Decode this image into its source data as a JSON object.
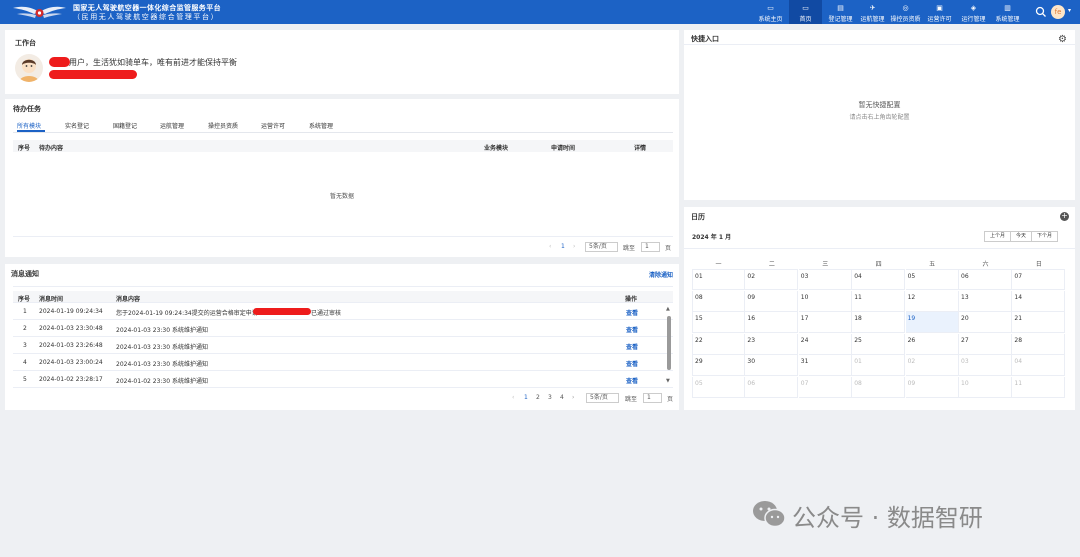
{
  "header": {
    "title_line1": "国家无人驾驶航空器一体化综合监管服务平台",
    "title_line2": "（民用无人驾驶航空器综合管理平台）",
    "nav": [
      {
        "label": "系统主页",
        "icon": "home-screen-icon"
      },
      {
        "label": "首页",
        "icon": "monitor-icon",
        "active": true
      },
      {
        "label": "登记管理",
        "icon": "register-icon"
      },
      {
        "label": "运航管理",
        "icon": "drone-icon"
      },
      {
        "label": "操控员资质",
        "icon": "badge-icon"
      },
      {
        "label": "运营许可",
        "icon": "license-icon"
      },
      {
        "label": "运行管理",
        "icon": "operation-icon"
      },
      {
        "label": "系统管理",
        "icon": "settings-icon"
      }
    ],
    "avatar_text": "fe"
  },
  "workbench": {
    "title": "工作台",
    "greeting": "用户，生活犹如骑单车，唯有前进才能保持平衡"
  },
  "tasks": {
    "title": "待办任务",
    "tabs": [
      "所有模块",
      "实名登记",
      "国籍登记",
      "运航管理",
      "操控员资质",
      "运营许可",
      "系统管理"
    ],
    "columns": [
      "序号",
      "待办内容",
      "业务模块",
      "申请时间",
      "详情"
    ],
    "empty_text": "暂无数据",
    "pager": {
      "prev": "‹",
      "page": "1",
      "next": "›",
      "page_size": "5条/页",
      "goto_label": "跳至",
      "goto_value": "1",
      "page_unit": "页"
    }
  },
  "messages": {
    "title": "消息通知",
    "clear_label": "清除通知",
    "columns": [
      "序号",
      "消息时间",
      "消息内容",
      "操作"
    ],
    "rows": [
      {
        "no": "1",
        "time": "2024-01-19 09:24:34",
        "content": "您于2024-01-19 09:24:34提交的运营合格审定申请",
        "content_tail": "已通过审核",
        "action": "查看"
      },
      {
        "no": "2",
        "time": "2024-01-03 23:30:48",
        "content": "2024-01-03 23:30 系统维护通知",
        "action": "查看"
      },
      {
        "no": "3",
        "time": "2024-01-03 23:26:48",
        "content": "2024-01-03 23:30 系统维护通知",
        "action": "查看"
      },
      {
        "no": "4",
        "time": "2024-01-03 23:00:24",
        "content": "2024-01-03 23:30 系统维护通知",
        "action": "查看"
      },
      {
        "no": "5",
        "time": "2024-01-02 23:28:17",
        "content": "2024-01-02 23:30 系统维护通知",
        "action": "查看"
      }
    ],
    "pager": {
      "prev": "‹",
      "pages": [
        "1",
        "2",
        "3",
        "4"
      ],
      "active_page": "1",
      "next": "›",
      "page_size": "5条/页",
      "goto_label": "跳至",
      "goto_value": "1",
      "page_unit": "页"
    }
  },
  "quick": {
    "title": "快捷入口",
    "empty_text": "暂无快捷配置",
    "hint": "请点击右上角齿轮配置"
  },
  "calendar": {
    "title": "日历",
    "month_label": "2024 年 1 月",
    "buttons": [
      "上个月",
      "今天",
      "下个月"
    ],
    "weekdays": [
      "一",
      "二",
      "三",
      "四",
      "五",
      "六",
      "日"
    ],
    "today": "19",
    "days": [
      [
        "01",
        "02",
        "03",
        "04",
        "05",
        "06",
        "07"
      ],
      [
        "08",
        "09",
        "10",
        "11",
        "12",
        "13",
        "14"
      ],
      [
        "15",
        "16",
        "17",
        "18",
        "19",
        "20",
        "21"
      ],
      [
        "22",
        "23",
        "24",
        "25",
        "26",
        "27",
        "28"
      ],
      [
        "29",
        "30",
        "31",
        "01",
        "02",
        "03",
        "04"
      ],
      [
        "05",
        "06",
        "07",
        "08",
        "09",
        "10",
        "11"
      ]
    ]
  },
  "watermark": "公众号 · 数据智研",
  "colors": {
    "brand": "#1c62c5",
    "redact": "#ee1c1c"
  }
}
